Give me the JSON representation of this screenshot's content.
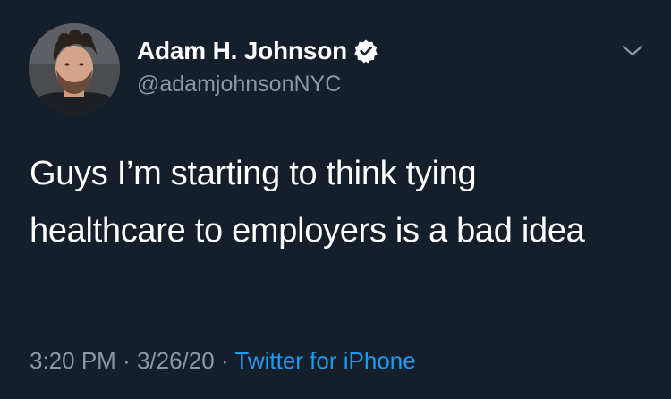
{
  "author": {
    "display_name": "Adam H. Johnson",
    "handle": "@adamjohnsonNYC",
    "verified": true,
    "avatar_icon": "profile-photo"
  },
  "tweet": {
    "text": "Guys I’m starting to think tying healthcare to employers is a bad idea",
    "time": "3:20 PM",
    "separator": "·",
    "date": "3/26/20",
    "source": "Twitter for iPhone"
  },
  "icons": {
    "verified": "verified-badge-icon",
    "menu": "chevron-down-icon"
  },
  "colors": {
    "background": "#151e2b",
    "text": "#ffffff",
    "secondary": "#8a98a6",
    "accent": "#1d9bf0"
  }
}
